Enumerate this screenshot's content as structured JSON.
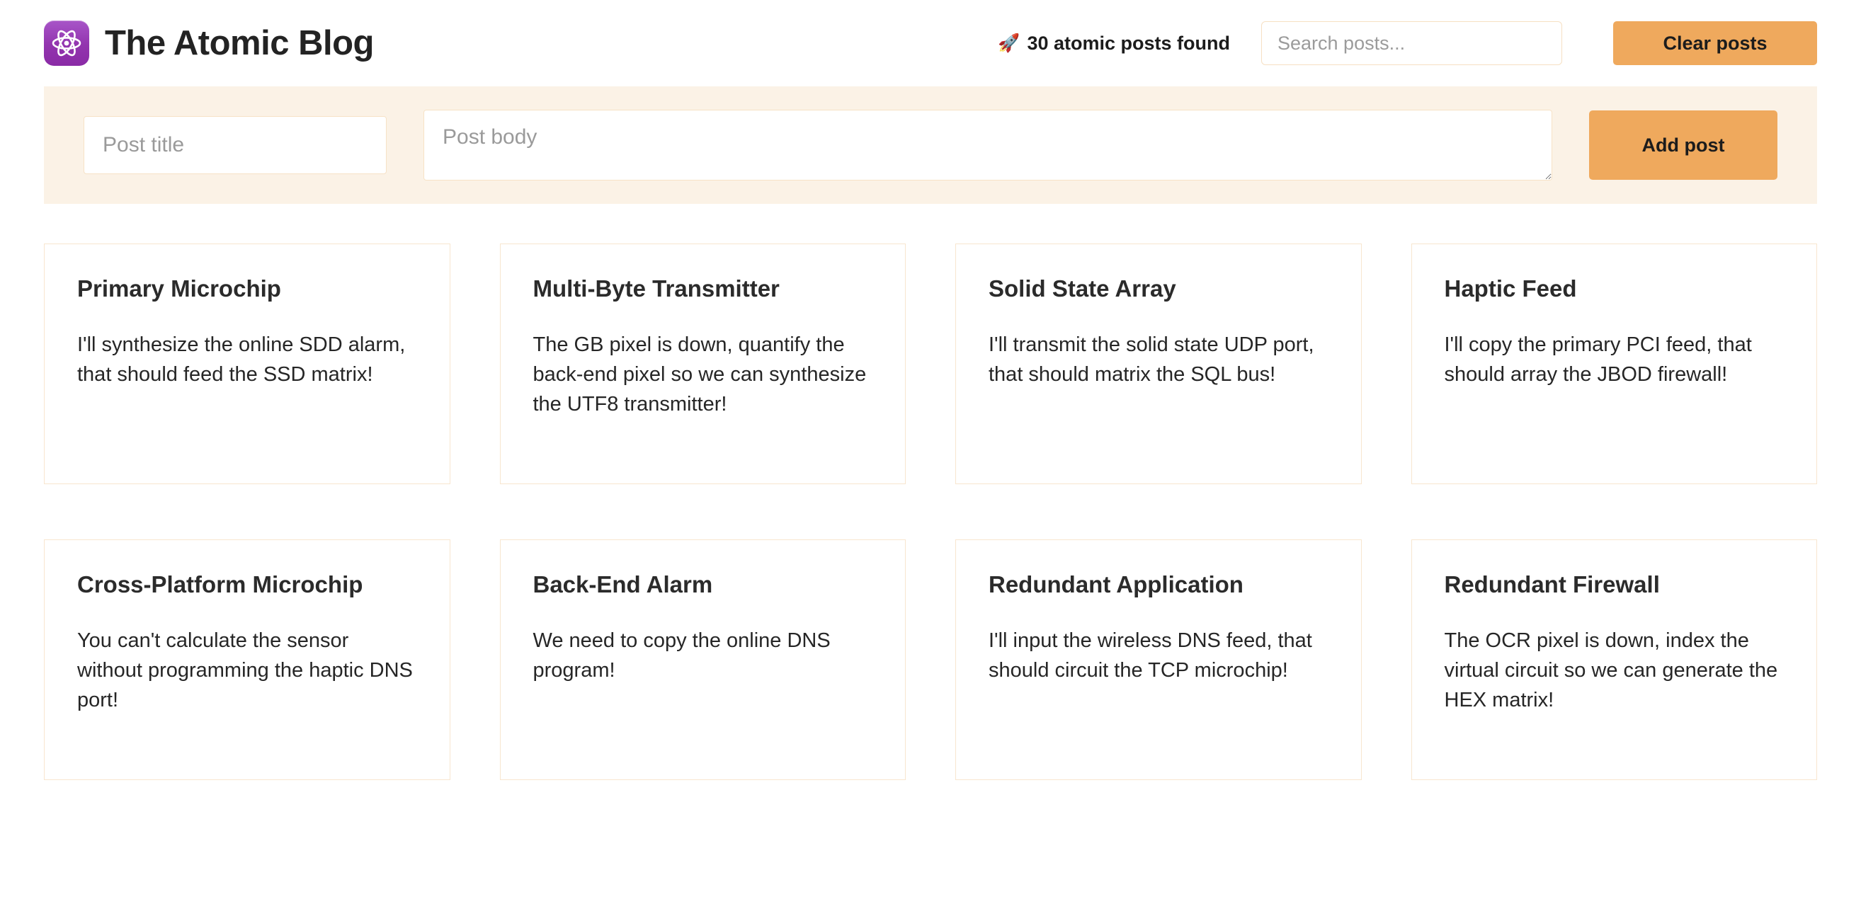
{
  "header": {
    "logo_icon": "atom-icon",
    "brand_title": "The Atomic Blog",
    "rocket_icon": "🚀",
    "results_count": "30 atomic posts found",
    "search": {
      "placeholder": "Search posts...",
      "value": ""
    },
    "clear_button_label": "Clear posts"
  },
  "form": {
    "title_placeholder": "Post title",
    "title_value": "",
    "body_placeholder": "Post body",
    "body_value": "",
    "add_button_label": "Add post"
  },
  "posts": [
    {
      "title": "Primary Microchip",
      "body": "I'll synthesize the online SDD alarm, that should feed the SSD matrix!"
    },
    {
      "title": "Multi-Byte Transmitter",
      "body": "The GB pixel is down, quantify the back-end pixel so we can synthesize the UTF8 transmitter!"
    },
    {
      "title": "Solid State Array",
      "body": "I'll transmit the solid state UDP port, that should matrix the SQL bus!"
    },
    {
      "title": "Haptic Feed",
      "body": "I'll copy the primary PCI feed, that should array the JBOD firewall!"
    },
    {
      "title": "Cross-Platform Microchip",
      "body": "You can't calculate the sensor without programming the haptic DNS port!"
    },
    {
      "title": "Back-End Alarm",
      "body": "We need to copy the online DNS program!"
    },
    {
      "title": "Redundant Application",
      "body": "I'll input the wireless DNS feed, that should circuit the TCP microchip!"
    },
    {
      "title": "Redundant Firewall",
      "body": "The OCR pixel is down, index the virtual circuit so we can generate the HEX matrix!"
    }
  ],
  "colors": {
    "accent_orange": "#efa95d",
    "form_background": "#fbf2e6",
    "card_border": "#f8e6cf",
    "logo_purple": "#9234ae",
    "page_background": "#ffffff"
  }
}
